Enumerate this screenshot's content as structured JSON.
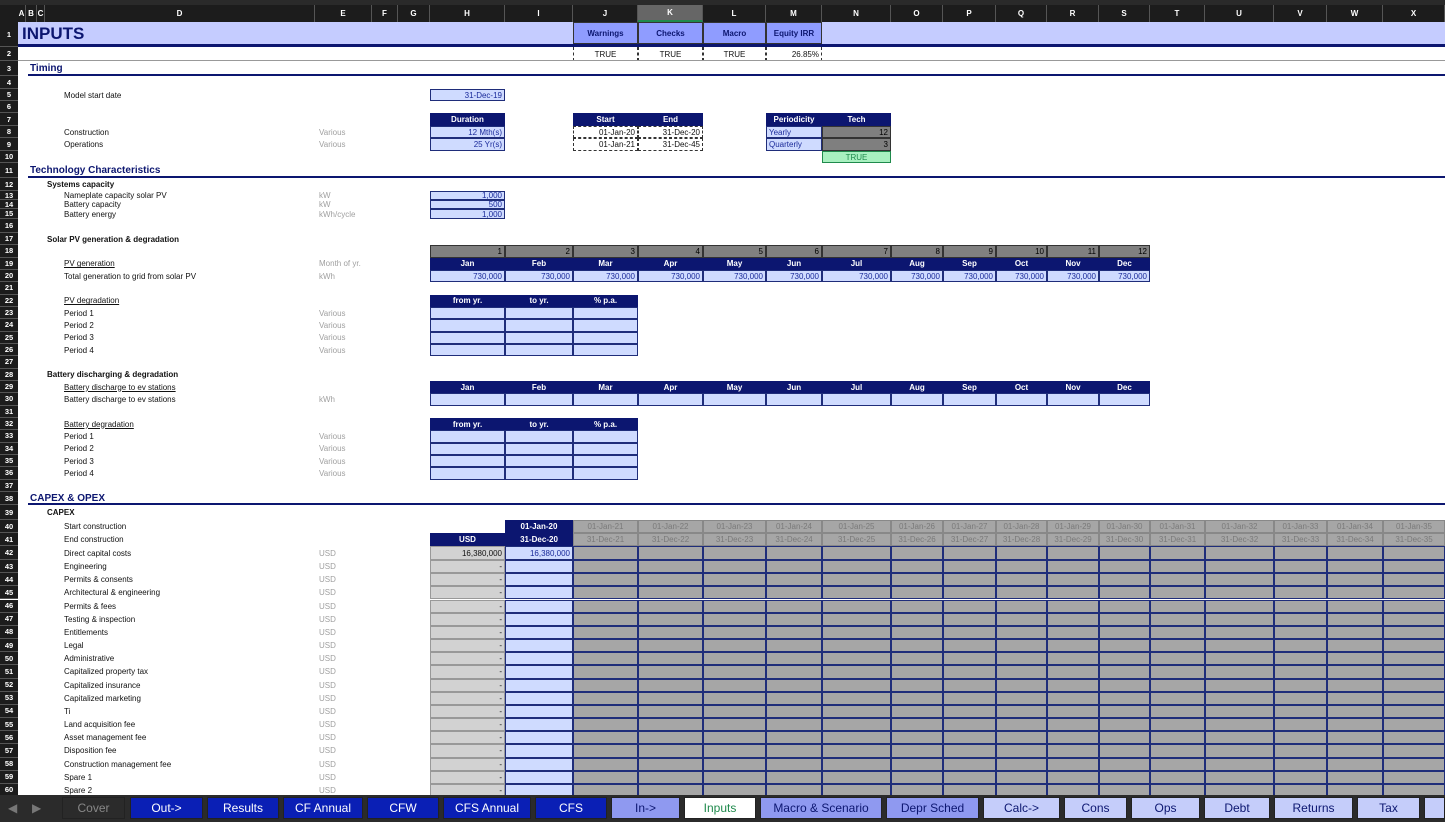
{
  "sheet": {
    "columns": [
      "A",
      "B",
      "C",
      "D",
      "E",
      "F",
      "G",
      "H",
      "I",
      "J",
      "K",
      "L",
      "M",
      "N",
      "O",
      "P",
      "Q",
      "R",
      "S",
      "T",
      "U",
      "V",
      "W",
      "X"
    ],
    "selected_column": "K",
    "title": "INPUTS",
    "status_buttons": [
      {
        "label": "Warnings",
        "value": "TRUE"
      },
      {
        "label": "Checks",
        "value": "TRUE"
      },
      {
        "label": "Macro",
        "value": "TRUE"
      },
      {
        "label": "Equity IRR",
        "value": "26.85%"
      }
    ],
    "timing": {
      "title": "Timing",
      "model_start_label": "Model start date",
      "model_start_value": "31-Dec-19",
      "duration_header": "Duration",
      "start_header": "Start",
      "end_header": "End",
      "rows": [
        {
          "label": "Construction",
          "unit": "Various",
          "duration": "12 Mth(s)",
          "start": "01-Jan-20",
          "end": "31-Dec-20"
        },
        {
          "label": "Operations",
          "unit": "Various",
          "duration": "25 Yr(s)",
          "start": "01-Jan-21",
          "end": "31-Dec-45"
        }
      ],
      "periodicity_header": "Periodicity",
      "tech_header": "Tech",
      "periodicity": [
        {
          "label": "Yearly",
          "value": "12"
        },
        {
          "label": "Quarterly",
          "value": "3"
        }
      ],
      "periodicity_check": "TRUE"
    },
    "technology": {
      "title": "Technology Characteristics",
      "systems_capacity_title": "Systems capacity",
      "capacity": [
        {
          "label": "Nameplate capacity solar PV",
          "unit": "kW",
          "value": "1,000"
        },
        {
          "label": "Battery capacity",
          "unit": "kW",
          "value": "500"
        },
        {
          "label": "Battery energy",
          "unit": "kWh/cycle",
          "value": "1,000"
        }
      ],
      "solar_title": "Solar PV generation & degradation",
      "month_numbers": [
        "1",
        "2",
        "3",
        "4",
        "5",
        "6",
        "7",
        "8",
        "9",
        "10",
        "11",
        "12"
      ],
      "months": [
        "Jan",
        "Feb",
        "Mar",
        "Apr",
        "May",
        "Jun",
        "Jul",
        "Aug",
        "Sep",
        "Oct",
        "Nov",
        "Dec"
      ],
      "pv_generation_label": "PV generation",
      "pv_generation_unit": "Month of yr.",
      "total_generation_label": "Total generation to grid from solar PV",
      "total_generation_unit": "kWh",
      "total_generation_values": [
        "730,000",
        "730,000",
        "730,000",
        "730,000",
        "730,000",
        "730,000",
        "730,000",
        "730,000",
        "730,000",
        "730,000",
        "730,000",
        "730,000"
      ],
      "pv_degradation_label": "PV degradation",
      "degradation_headers": [
        "from yr.",
        "to yr.",
        "% p.a."
      ],
      "periods": [
        {
          "label": "Period 1",
          "unit": "Various"
        },
        {
          "label": "Period 2",
          "unit": "Various"
        },
        {
          "label": "Period 3",
          "unit": "Various"
        },
        {
          "label": "Period 4",
          "unit": "Various"
        }
      ],
      "battery_title": "Battery discharging & degradation",
      "battery_discharge_header_label": "Battery discharge to ev stations",
      "battery_discharge_label": "Battery discharge to ev stations",
      "battery_discharge_unit": "kWh",
      "battery_degradation_label": "Battery degradation"
    },
    "capex_opex": {
      "title": "CAPEX & OPEX",
      "capex_title": "CAPEX",
      "start_label": "Start  construction",
      "end_label": "End construction",
      "total_header": "USD",
      "period_starts": [
        "01-Jan-20",
        "01-Jan-21",
        "01-Jan-22",
        "01-Jan-23",
        "01-Jan-24",
        "01-Jan-25",
        "01-Jan-26",
        "01-Jan-27",
        "01-Jan-28",
        "01-Jan-29",
        "01-Jan-30",
        "01-Jan-31",
        "01-Jan-32",
        "01-Jan-33",
        "01-Jan-34",
        "01-Jan-35"
      ],
      "period_ends": [
        "31-Dec-20",
        "31-Dec-21",
        "31-Dec-22",
        "31-Dec-23",
        "31-Dec-24",
        "31-Dec-25",
        "31-Dec-26",
        "31-Dec-27",
        "31-Dec-28",
        "31-Dec-29",
        "31-Dec-30",
        "31-Dec-31",
        "31-Dec-32",
        "31-Dec-33",
        "31-Dec-34",
        "31-Dec-35"
      ],
      "items": [
        {
          "label": "Direct capital costs",
          "unit": "USD",
          "total": "16,380,000",
          "first_period": "16,380,000"
        },
        {
          "label": "Engineering",
          "unit": "USD",
          "total": "-",
          "first_period": ""
        },
        {
          "label": "Permits & consents",
          "unit": "USD",
          "total": "-",
          "first_period": ""
        },
        {
          "label": "Architectural & engineering",
          "unit": "USD",
          "total": "-",
          "first_period": ""
        },
        {
          "label": "Permits & fees",
          "unit": "USD",
          "total": "-",
          "first_period": ""
        },
        {
          "label": "Testing & inspection",
          "unit": "USD",
          "total": "-",
          "first_period": ""
        },
        {
          "label": "Entitlements",
          "unit": "USD",
          "total": "-",
          "first_period": ""
        },
        {
          "label": "Legal",
          "unit": "USD",
          "total": "-",
          "first_period": ""
        },
        {
          "label": "Administrative",
          "unit": "USD",
          "total": "-",
          "first_period": ""
        },
        {
          "label": "Capitalized property tax",
          "unit": "USD",
          "total": "-",
          "first_period": ""
        },
        {
          "label": "Capitalized insurance",
          "unit": "USD",
          "total": "-",
          "first_period": ""
        },
        {
          "label": "Capitalized marketing",
          "unit": "USD",
          "total": "-",
          "first_period": ""
        },
        {
          "label": "Ti",
          "unit": "USD",
          "total": "-",
          "first_period": ""
        },
        {
          "label": "Land acquisition fee",
          "unit": "USD",
          "total": "-",
          "first_period": ""
        },
        {
          "label": "Asset management fee",
          "unit": "USD",
          "total": "-",
          "first_period": ""
        },
        {
          "label": "Disposition fee",
          "unit": "USD",
          "total": "-",
          "first_period": ""
        },
        {
          "label": "Construction management fee",
          "unit": "USD",
          "total": "-",
          "first_period": ""
        },
        {
          "label": "Spare 1",
          "unit": "USD",
          "total": "-",
          "first_period": ""
        },
        {
          "label": "Spare 2",
          "unit": "USD",
          "total": "-",
          "first_period": ""
        }
      ]
    }
  },
  "tabs": [
    {
      "label": "Cover",
      "style": "cover"
    },
    {
      "label": "Out->",
      "style": "dark"
    },
    {
      "label": "Results",
      "style": "dark"
    },
    {
      "label": "CF Annual",
      "style": "dark"
    },
    {
      "label": "CFW",
      "style": "dark"
    },
    {
      "label": "CFS Annual",
      "style": "dark"
    },
    {
      "label": "CFS",
      "style": "dark"
    },
    {
      "label": "In->",
      "style": "mid"
    },
    {
      "label": "Inputs",
      "style": "active"
    },
    {
      "label": "Macro & Scenario",
      "style": "mid"
    },
    {
      "label": "Depr Sched",
      "style": "mid"
    },
    {
      "label": "Calc->",
      "style": "light"
    },
    {
      "label": "Cons",
      "style": "light"
    },
    {
      "label": "Ops",
      "style": "light"
    },
    {
      "label": "Debt",
      "style": "light"
    },
    {
      "label": "Returns",
      "style": "light"
    },
    {
      "label": "Tax",
      "style": "light"
    }
  ],
  "colors": {
    "navy": "#0c1670",
    "input": "#cfdbff",
    "title_band": "#c5ccff",
    "button": "#8f9cff",
    "check_ok": "#a8f0c0",
    "active_tab_text": "#1f8a4c"
  }
}
